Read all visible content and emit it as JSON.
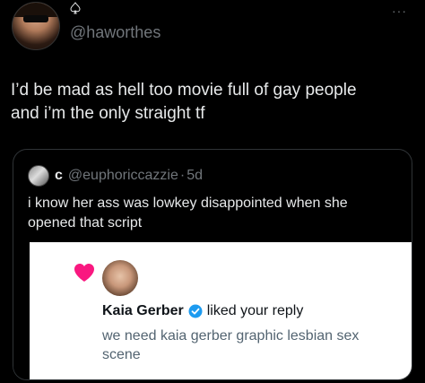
{
  "post": {
    "handle": "@haworthes",
    "text_line1": "I’d be mad as hell too movie full of gay people",
    "text_line2": "and i’m the only straight tf",
    "more": "···"
  },
  "quote": {
    "author_name": "c",
    "author_handle": "@euphoriccazzie",
    "separator": "·",
    "time": "5d",
    "text_line1": "i know her ass was lowkey disappointed when she",
    "text_line2": "opened that script"
  },
  "notification": {
    "name": "Kaia Gerber",
    "action": "liked your reply",
    "reply_line1": "we need kaia gerber graphic lesbian sex",
    "reply_line2": "scene"
  },
  "colors": {
    "background": "#000000",
    "text_primary": "#e7e9ea",
    "text_secondary": "#71767b",
    "border": "#2f3336",
    "heart": "#f91880",
    "verified": "#1d9bf0"
  }
}
